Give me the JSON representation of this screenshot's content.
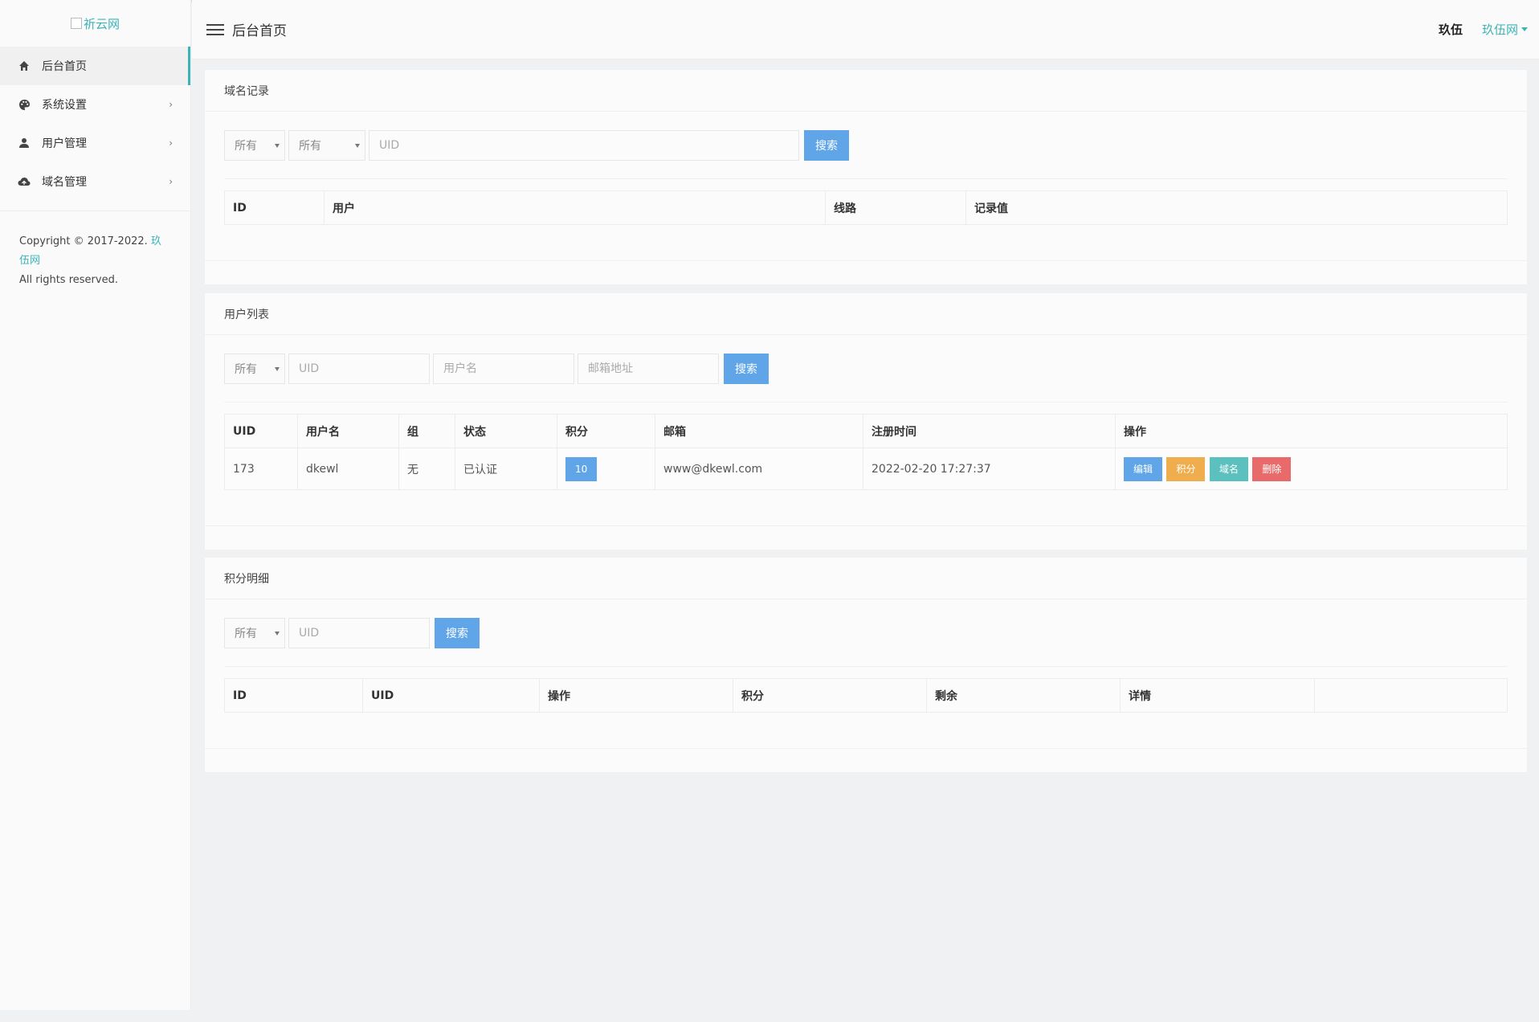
{
  "sidebar": {
    "logo_alt": "祈云网",
    "items": [
      {
        "label": "后台首页",
        "icon": "home-icon",
        "active": true
      },
      {
        "label": "系统设置",
        "icon": "palette-icon",
        "has_children": true
      },
      {
        "label": "用户管理",
        "icon": "user-icon",
        "has_children": true
      },
      {
        "label": "域名管理",
        "icon": "cloud-icon",
        "has_children": true
      }
    ],
    "chevron": "›",
    "copyright_prefix": "Copyright © 2017-2022.",
    "copyright_link": "玖伍网",
    "copyright_suffix": "All rights reserved."
  },
  "header": {
    "title": "后台首页",
    "username": "玖伍",
    "site": "玖伍网"
  },
  "domain_records": {
    "title": "域名记录",
    "filter1": "所有",
    "filter2": "所有",
    "uid_placeholder": "UID",
    "search_label": "搜索",
    "columns": [
      "ID",
      "用户",
      "线路",
      "记录值"
    ]
  },
  "user_list": {
    "title": "用户列表",
    "filter": "所有",
    "uid_placeholder": "UID",
    "username_placeholder": "用户名",
    "email_placeholder": "邮箱地址",
    "search_label": "搜索",
    "columns": [
      "UID",
      "用户名",
      "组",
      "状态",
      "积分",
      "邮箱",
      "注册时间",
      "操作"
    ],
    "rows": [
      {
        "uid": "173",
        "username": "dkewl",
        "group": "无",
        "status": "已认证",
        "points": "10",
        "email": "www@dkewl.com",
        "registered": "2022-02-20 17:27:37",
        "actions": [
          "编辑",
          "积分",
          "域名",
          "删除"
        ]
      }
    ]
  },
  "points_detail": {
    "title": "积分明细",
    "filter": "所有",
    "uid_placeholder": "UID",
    "search_label": "搜索",
    "columns": [
      "ID",
      "UID",
      "操作",
      "积分",
      "剩余",
      "详情",
      ""
    ]
  },
  "colors": {
    "accent": "#3bb4b6",
    "primary_button": "#5fa5e8",
    "warn_button": "#f0ad4e",
    "info_button": "#5bc0be",
    "danger_button": "#e96a6a"
  }
}
